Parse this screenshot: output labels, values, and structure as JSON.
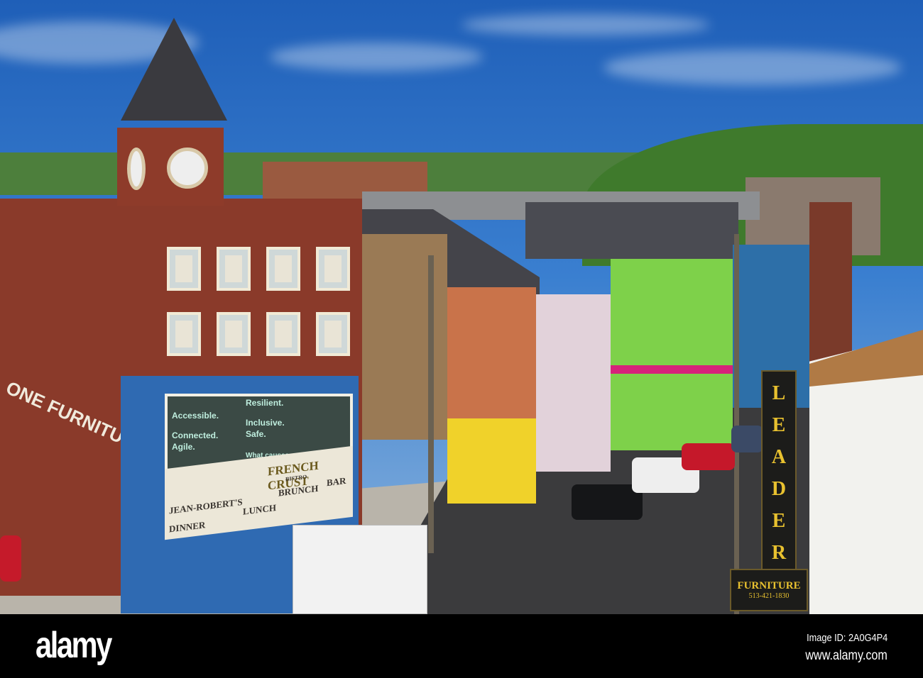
{
  "photo": {
    "storefront": {
      "window_lines": [
        "Accessible.",
        "Resilient.",
        "Inclusive.",
        "Safe.",
        "Connected.",
        "Agile.",
        "What causes you"
      ],
      "restaurant_owner": "JEAN-ROBERT'S",
      "restaurant_name": "FRENCH CRUST",
      "restaurant_sub": "BISTRO",
      "menu": [
        "DINNER",
        "LUNCH",
        "BRUNCH",
        "BAR"
      ]
    },
    "wall_sign": "ONE FURNITURE",
    "leader_sign": {
      "letters": [
        "L",
        "E",
        "A",
        "D",
        "E",
        "R"
      ],
      "furniture": "FURNITURE",
      "phone": "513-421-1830"
    }
  },
  "watermark": {
    "logo": "alamy",
    "image_id": "Image ID: 2A0G4P4",
    "url": "www.alamy.com"
  }
}
